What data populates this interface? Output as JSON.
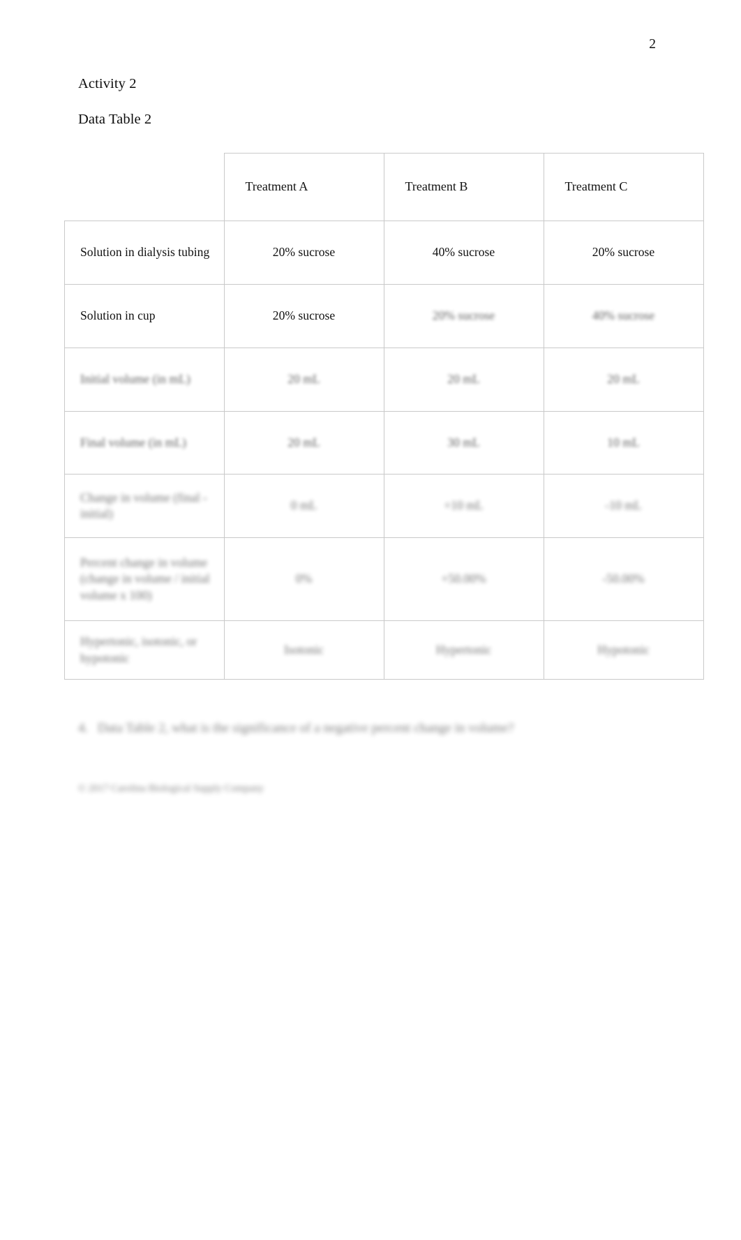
{
  "page": {
    "number": "2"
  },
  "headings": {
    "activity": "Activity 2",
    "data_table": "Data Table 2"
  },
  "table": {
    "corner": "",
    "columns": [
      "Treatment A",
      "Treatment B",
      "Treatment C"
    ],
    "rows": [
      {
        "label": "Solution in dialysis tubing",
        "values": [
          "20% sucrose",
          "40% sucrose",
          "20% sucrose"
        ]
      },
      {
        "label": "Solution in cup",
        "values": [
          "20% sucrose",
          "20% sucrose",
          "40% sucrose"
        ]
      },
      {
        "label": "Initial volume (in mL)",
        "values": [
          "20 mL",
          "20 mL",
          "20 mL"
        ]
      },
      {
        "label": "Final volume (in mL)",
        "values": [
          "20 mL",
          "30 mL",
          "10 mL"
        ]
      },
      {
        "label": "Change in volume (final - initial)",
        "values": [
          "0 mL",
          "+10 mL",
          "-10 mL"
        ]
      },
      {
        "label": "Percent change in volume (change in volume / initial volume x 100)",
        "values": [
          "0%",
          "+50.00%",
          "-50.00%"
        ]
      },
      {
        "label": "Hypertonic, isotonic, or hypotonic",
        "values": [
          "Isotonic",
          "Hypertonic",
          "Hypotonic"
        ]
      }
    ]
  },
  "question": {
    "number": "4.",
    "text": "Data Table 2, what is the significance of a negative percent change in volume?"
  },
  "footer": {
    "copyright": "© 2017 Carolina Biological Supply Company"
  }
}
